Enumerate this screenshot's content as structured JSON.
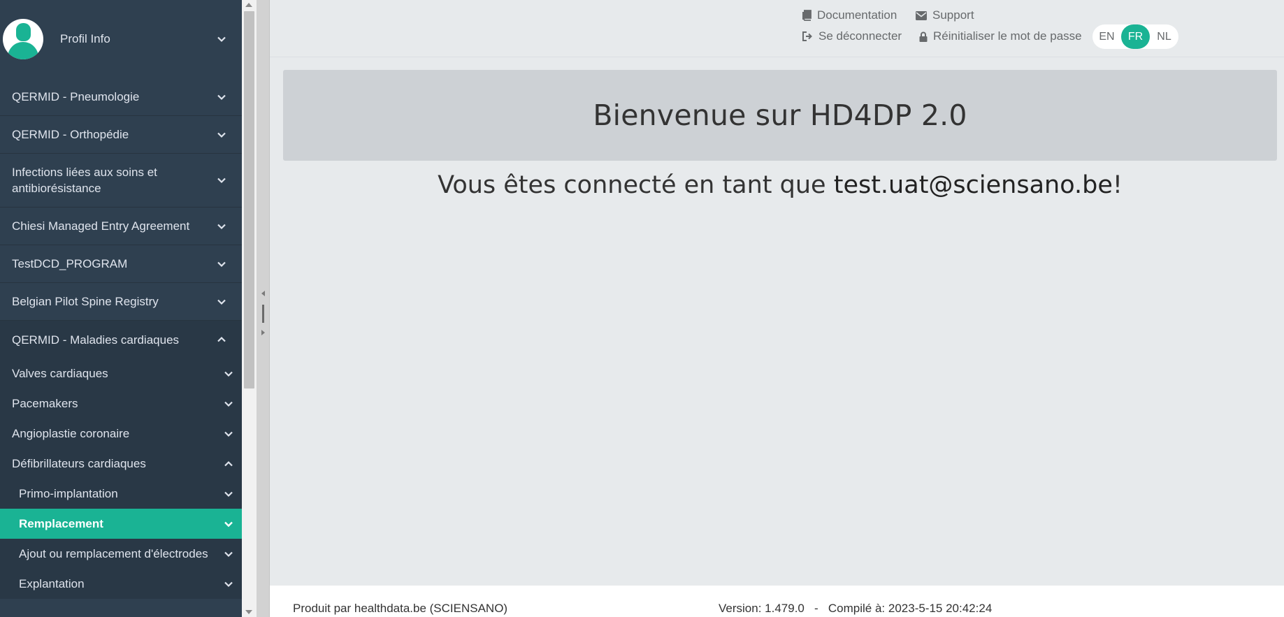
{
  "sidebar": {
    "profile": {
      "label": "Profil Info"
    },
    "items": [
      {
        "label": "QERMID - Pneumologie"
      },
      {
        "label": "QERMID - Orthopédie"
      },
      {
        "label": "Infections liées aux soins et antibiorésistance"
      },
      {
        "label": "Chiesi Managed Entry Agreement"
      },
      {
        "label": "TestDCD_PROGRAM"
      },
      {
        "label": "Belgian Pilot Spine Registry"
      },
      {
        "label": "QERMID - Maladies cardiaques"
      }
    ],
    "cardiac_sub": [
      {
        "label": "Valves cardiaques"
      },
      {
        "label": "Pacemakers"
      },
      {
        "label": "Angioplastie coronaire"
      },
      {
        "label": "Défibrillateurs cardiaques"
      }
    ],
    "defib_sub": [
      {
        "label": "Primo-implantation"
      },
      {
        "label": "Remplacement"
      },
      {
        "label": "Ajout ou remplacement d'électrodes"
      },
      {
        "label": "Explantation"
      }
    ]
  },
  "header": {
    "documentation": "Documentation",
    "support": "Support",
    "logout": "Se déconnecter",
    "reset_password": "Réinitialiser le mot de passe",
    "languages": [
      "EN",
      "FR",
      "NL"
    ],
    "active_language": "FR"
  },
  "main": {
    "welcome_title": "Bienvenue sur HD4DP 2.0",
    "connected_prefix": "Vous êtes connecté en tant que ",
    "connected_user": "test.uat@sciensano.be",
    "connected_suffix": "!"
  },
  "footer": {
    "produced_by": "Produit par healthdata.be (SCIENSANO)",
    "version_label": "Version: 1.479.0",
    "separator": "-",
    "compiled_label": "Compilé à: 2023-5-15 20:42:24"
  },
  "colors": {
    "sidebar_bg": "#2f4050",
    "accent": "#1ab394",
    "main_bg": "#e7eaec"
  }
}
